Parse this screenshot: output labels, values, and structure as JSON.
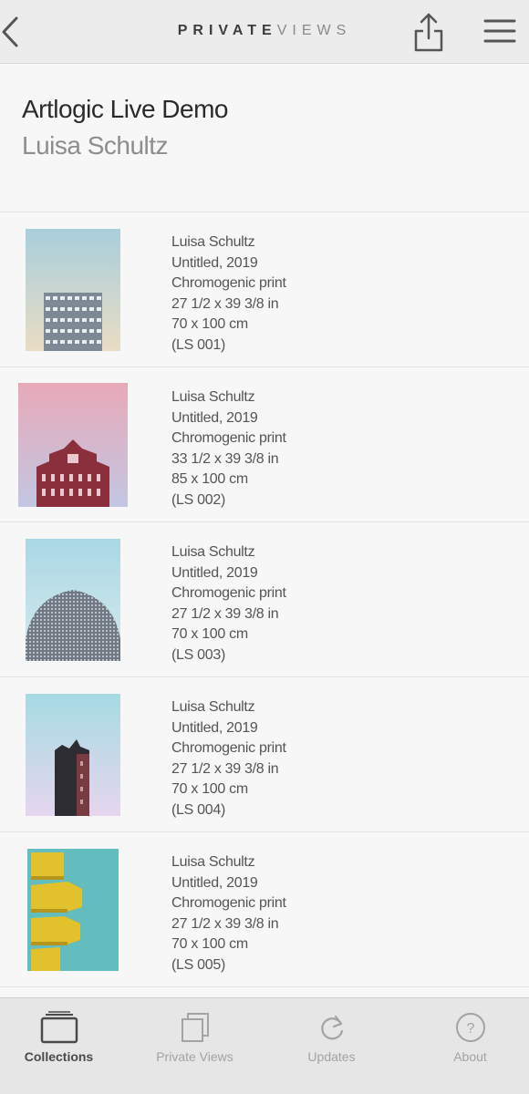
{
  "header": {
    "brand_bold": "PRIVATE",
    "brand_light": "VIEWS"
  },
  "page": {
    "title": "Artlogic Live Demo",
    "subtitle": "Luisa Schultz"
  },
  "artworks": [
    {
      "artist": "Luisa Schultz",
      "title": "Untitled, 2019",
      "medium": "Chromogenic print",
      "dims_in": "27 1/2 x 39 3/8 in",
      "dims_cm": "70 x 100 cm",
      "ref": "(LS 001)"
    },
    {
      "artist": "Luisa Schultz",
      "title": "Untitled, 2019",
      "medium": "Chromogenic print",
      "dims_in": "33 1/2 x 39 3/8 in",
      "dims_cm": "85 x 100 cm",
      "ref": "(LS 002)"
    },
    {
      "artist": "Luisa Schultz",
      "title": "Untitled, 2019",
      "medium": "Chromogenic print",
      "dims_in": "27 1/2 x 39 3/8 in",
      "dims_cm": "70 x 100 cm",
      "ref": "(LS 003)"
    },
    {
      "artist": "Luisa Schultz",
      "title": "Untitled, 2019",
      "medium": "Chromogenic print",
      "dims_in": "27 1/2 x 39 3/8 in",
      "dims_cm": "70 x 100 cm",
      "ref": "(LS 004)"
    },
    {
      "artist": "Luisa Schultz",
      "title": "Untitled, 2019",
      "medium": "Chromogenic print",
      "dims_in": "27 1/2 x 39 3/8 in",
      "dims_cm": "70 x 100 cm",
      "ref": "(LS 005)"
    }
  ],
  "tabs": [
    {
      "label": "Collections",
      "icon": "collections-icon",
      "active": true
    },
    {
      "label": "Private Views",
      "icon": "private-views-icon",
      "active": false
    },
    {
      "label": "Updates",
      "icon": "refresh-icon",
      "active": false
    },
    {
      "label": "About",
      "icon": "help-icon",
      "active": false
    }
  ],
  "colors": {
    "tab_active": "#4a4a4a",
    "tab_inactive": "#a3a3a3",
    "topbar_bg": "#ececec"
  }
}
